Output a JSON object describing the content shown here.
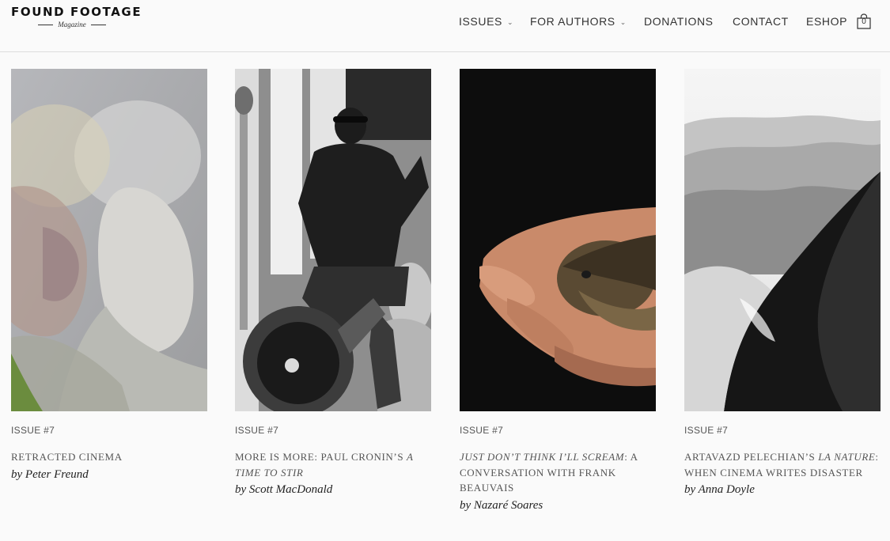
{
  "site": {
    "logo_title": "FOUND FOOTAGE",
    "logo_subtitle": "Magazine"
  },
  "nav": {
    "items": [
      {
        "label": "ISSUES",
        "dropdown": true
      },
      {
        "label": "FOR AUTHORS",
        "dropdown": true
      },
      {
        "label": "DONATIONS",
        "dropdown": false
      },
      {
        "label": "CONTACT",
        "dropdown": false
      },
      {
        "label": "ESHOP",
        "dropdown": false
      }
    ],
    "cart_count": "0"
  },
  "articles": [
    {
      "issue": "ISSUE #7",
      "title_parts": [
        "RETRACTED CINEMA"
      ],
      "author": "by Peter Freund",
      "image_icon": "double-exposure-portrait"
    },
    {
      "issue": "ISSUE #7",
      "title_parts": [
        "MORE IS MORE: PAUL CRONIN’S ",
        "A TIME TO STIR"
      ],
      "author": "by Scott MacDonald",
      "image_icon": "protester-with-megaphone-photo"
    },
    {
      "issue": "ISSUE #7",
      "title_parts": [
        "JUST DON’T THINK I’LL SCREAM",
        ": A CONVERSATION WITH FRANK BEAUVAIS"
      ],
      "author": "by Nazaré Soares",
      "image_icon": "bird-in-hand-photo"
    },
    {
      "issue": "ISSUE #7",
      "title_parts": [
        "ARTAVAZD PELECHIAN’S ",
        "LA NATURE",
        ": WHEN CINEMA WRITES DISASTER"
      ],
      "author": "by Anna Doyle",
      "image_icon": "desert-dunes-photo"
    }
  ]
}
